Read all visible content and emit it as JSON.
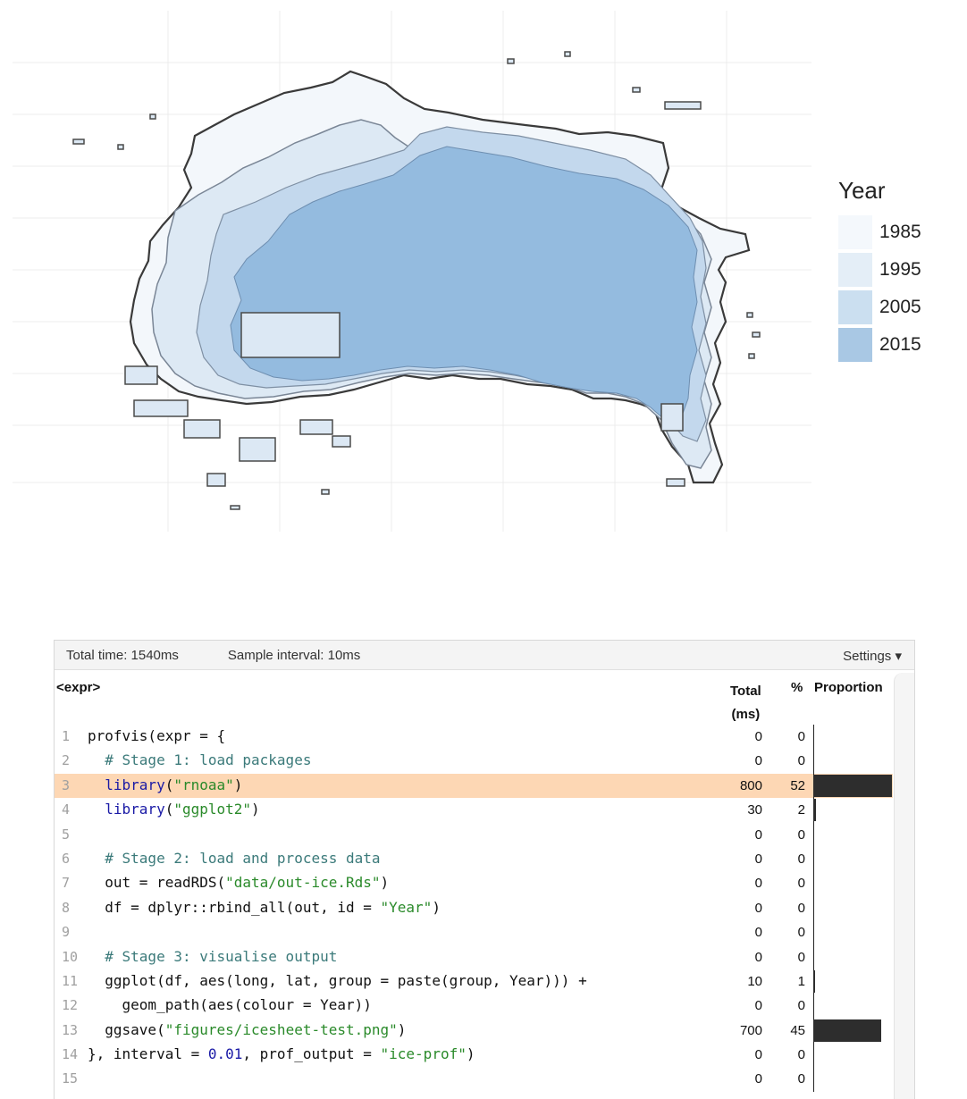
{
  "map": {
    "legend": {
      "title": "Year",
      "items": [
        {
          "label": "1985",
          "color": "#f4f8fc"
        },
        {
          "label": "1995",
          "color": "#e4eef7"
        },
        {
          "label": "2005",
          "color": "#cbdff0"
        },
        {
          "label": "2015",
          "color": "#a9c8e4"
        }
      ]
    },
    "colors": {
      "outline": "#3a3a3a",
      "fill_2015": "#96bcdf",
      "fill_2005": "#bdd5ec",
      "fill_1995": "#dbe8f4",
      "fill_1985": "#eef4fa",
      "grid": "#ececec"
    }
  },
  "profvis": {
    "total_time": "Total time: 1540ms",
    "sample_interval": "Sample interval: 10ms",
    "settings": "Settings ▾",
    "columns": {
      "expr": "<expr>",
      "total": "Total",
      "total_unit": "(ms)",
      "pct": "%",
      "proportion": "Proportion"
    },
    "rows": [
      {
        "line": "1",
        "code": "profvis(expr = {",
        "total": "0",
        "pct": "0",
        "prop": 0
      },
      {
        "line": "2",
        "code": "  # Stage 1: load packages",
        "total": "0",
        "pct": "0",
        "prop": 0
      },
      {
        "line": "3",
        "code": "  library(\"rnoaa\")",
        "total": "800",
        "pct": "52",
        "prop": 0.52,
        "highlight": true
      },
      {
        "line": "4",
        "code": "  library(\"ggplot2\")",
        "total": "30",
        "pct": "2",
        "prop": 0.02
      },
      {
        "line": "5",
        "code": "",
        "total": "0",
        "pct": "0",
        "prop": 0
      },
      {
        "line": "6",
        "code": "  # Stage 2: load and process data",
        "total": "0",
        "pct": "0",
        "prop": 0
      },
      {
        "line": "7",
        "code": "  out = readRDS(\"data/out-ice.Rds\")",
        "total": "0",
        "pct": "0",
        "prop": 0
      },
      {
        "line": "8",
        "code": "  df = dplyr::rbind_all(out, id = \"Year\")",
        "total": "0",
        "pct": "0",
        "prop": 0
      },
      {
        "line": "9",
        "code": "",
        "total": "0",
        "pct": "0",
        "prop": 0
      },
      {
        "line": "10",
        "code": "  # Stage 3: visualise output",
        "total": "0",
        "pct": "0",
        "prop": 0
      },
      {
        "line": "11",
        "code": "  ggplot(df, aes(long, lat, group = paste(group, Year))) +",
        "total": "10",
        "pct": "1",
        "prop": 0.01
      },
      {
        "line": "12",
        "code": "    geom_path(aes(colour = Year))",
        "total": "0",
        "pct": "0",
        "prop": 0
      },
      {
        "line": "13",
        "code": "  ggsave(\"figures/icesheet-test.png\")",
        "total": "700",
        "pct": "45",
        "prop": 0.45
      },
      {
        "line": "14",
        "code": "}, interval = 0.01, prof_output = \"ice-prof\")",
        "total": "0",
        "pct": "0",
        "prop": 0
      },
      {
        "line": "15",
        "code": "",
        "total": "0",
        "pct": "0",
        "prop": 0
      }
    ]
  }
}
